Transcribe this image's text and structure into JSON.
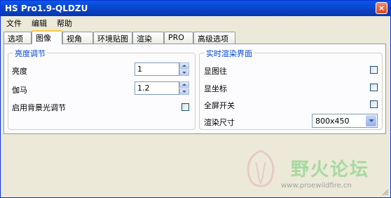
{
  "window": {
    "title": "HS Pro1.9-QLDZU",
    "close_glyph": "×"
  },
  "menu": [
    "文件",
    "编辑",
    "帮助"
  ],
  "tabs": [
    "选项",
    "图像",
    "视角",
    "环境贴图",
    "渲染",
    "PRO",
    "高级选项"
  ],
  "active_tab": "图像",
  "brightness_group": {
    "title": "亮度调节",
    "brightness_label": "亮度",
    "brightness_value": "1",
    "gamma_label": "伽马",
    "gamma_value": "1.2",
    "backlight_label": "启用背景光调节",
    "backlight_checked": false
  },
  "realtime_group": {
    "title": "实时渲染界面",
    "show_pin_label": "显图往",
    "show_pin_checked": false,
    "show_coords_label": "显坐标",
    "show_coords_checked": false,
    "fullscreen_label": "全屏开关",
    "fullscreen_checked": false,
    "render_size_label": "渲染尺寸",
    "render_size_value": "800x450"
  },
  "watermark": {
    "text": "野火论坛",
    "url": "www.proewildfire.cn"
  },
  "colors": {
    "titlebar": "#0a58e8",
    "group_title": "#0046d5",
    "active_tab_accent": "#ffc83c"
  }
}
